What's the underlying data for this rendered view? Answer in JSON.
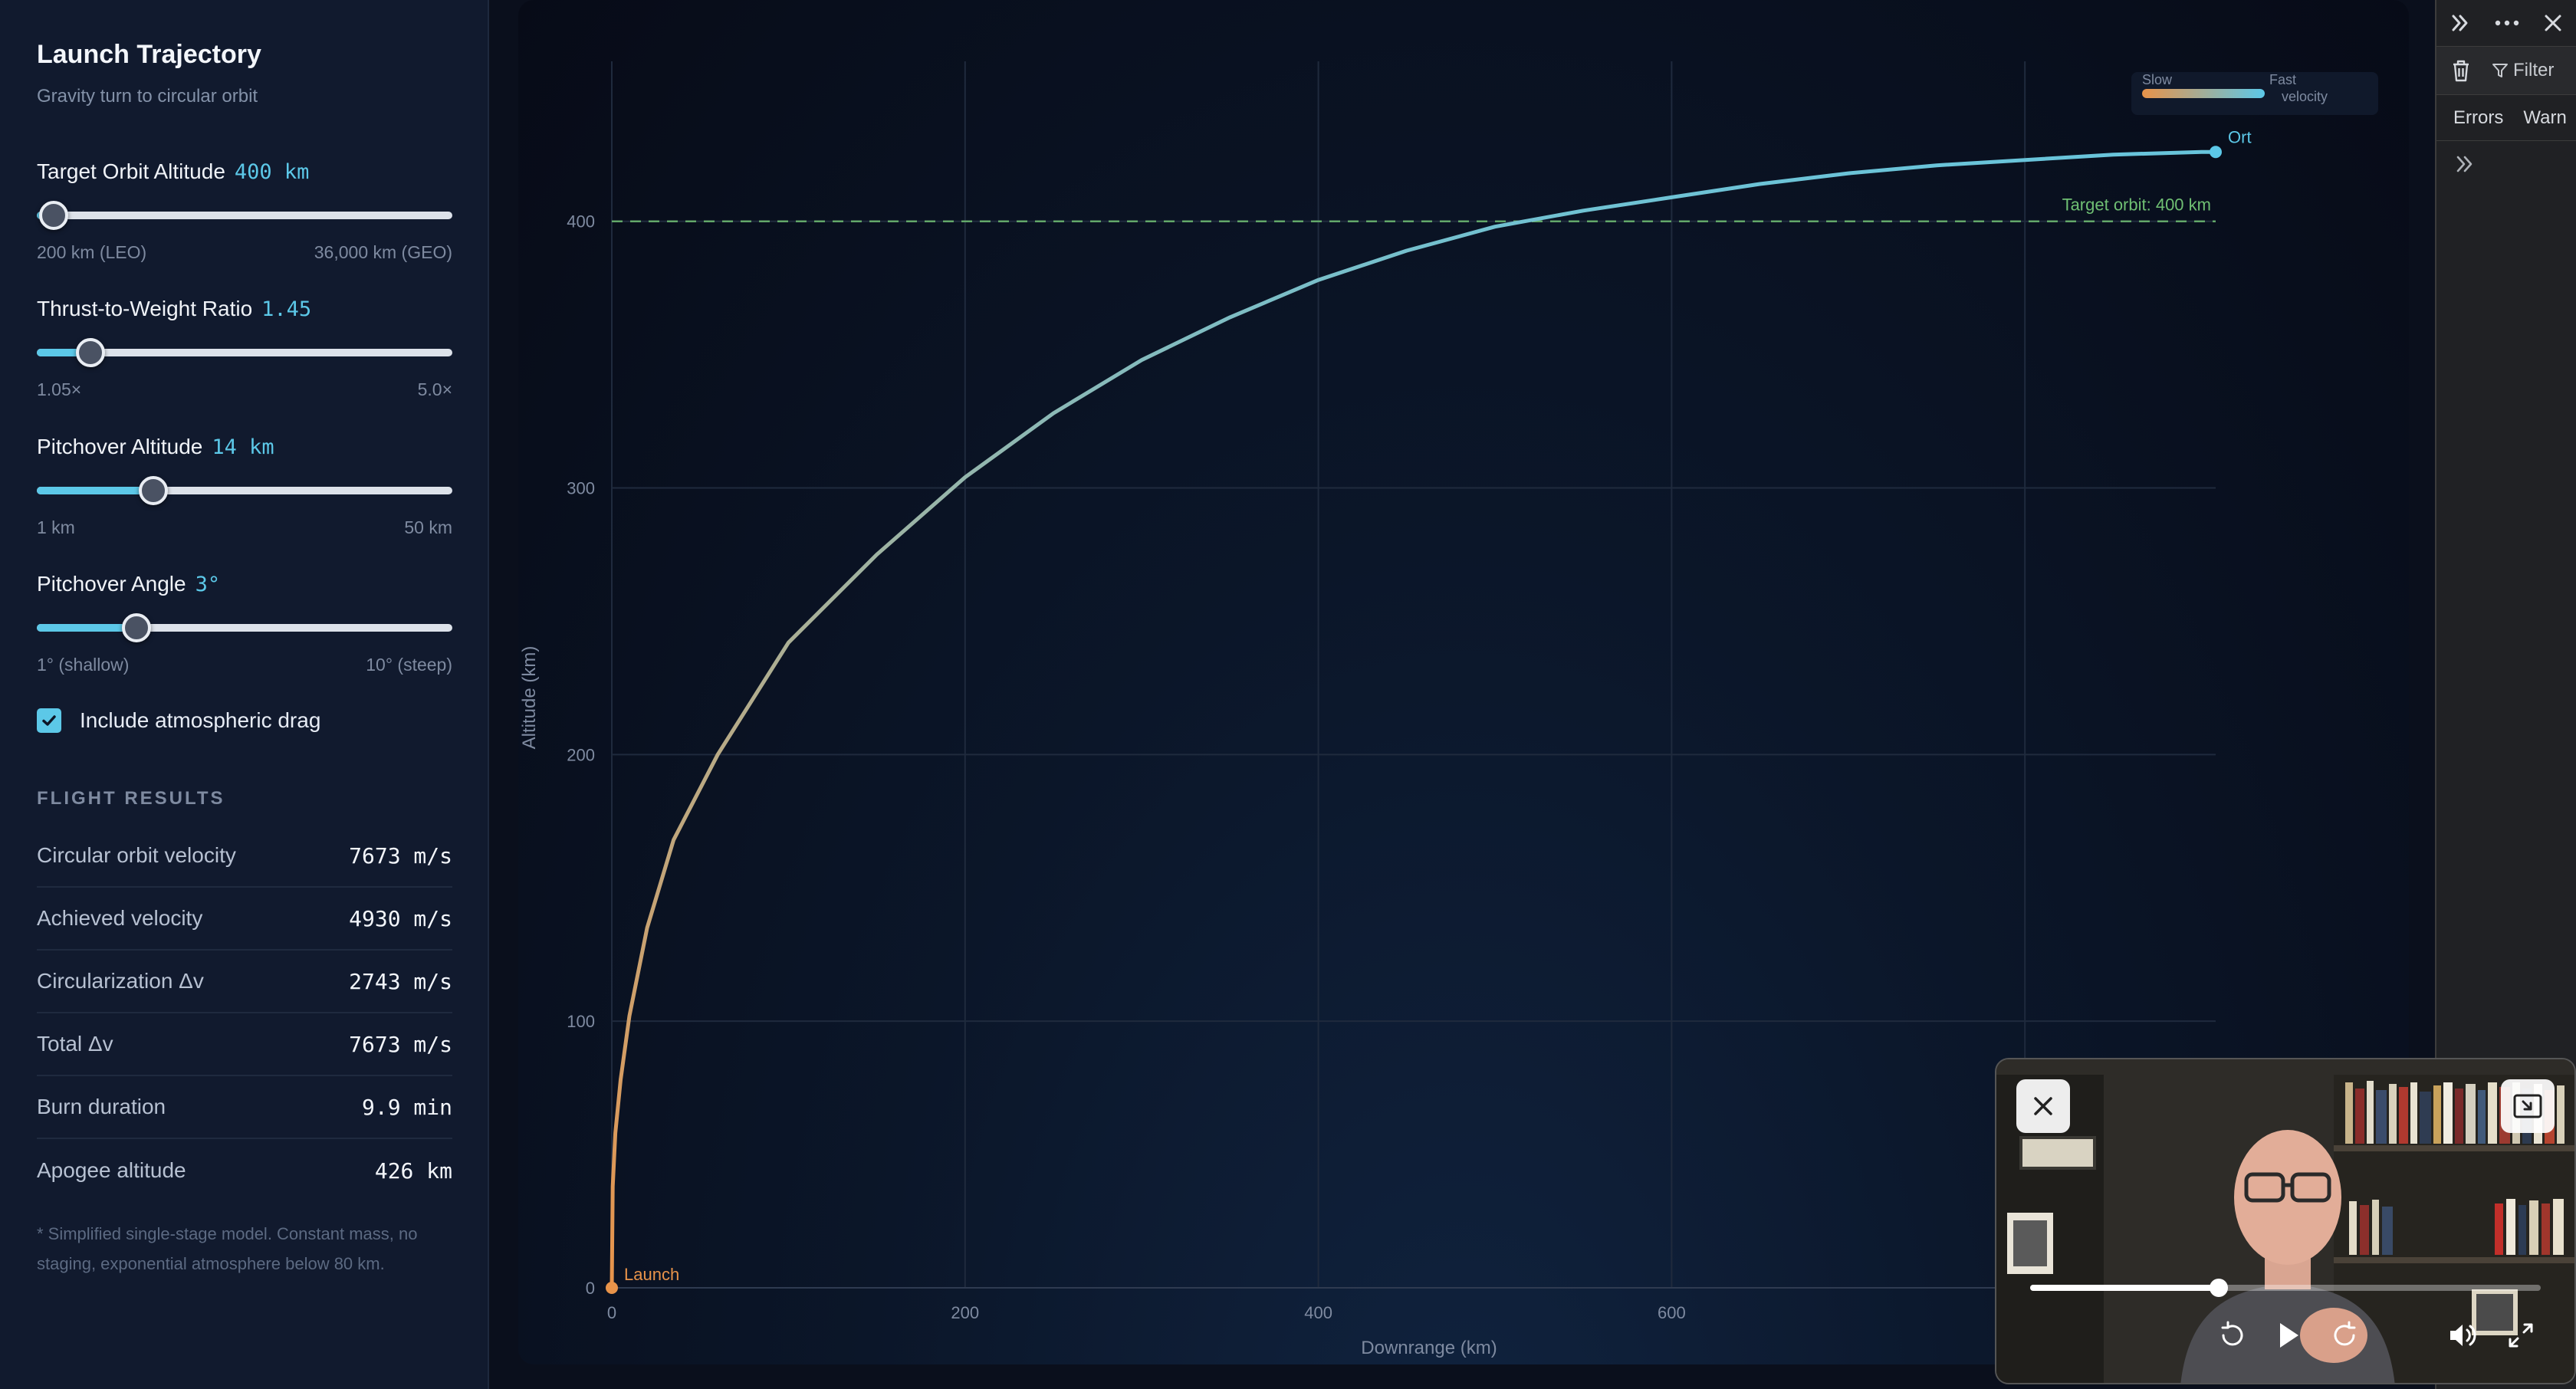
{
  "sidebar": {
    "title": "Launch Trajectory",
    "subtitle": "Gravity turn to circular orbit",
    "controls": [
      {
        "label": "Target Orbit Altitude",
        "value": "400 km",
        "min_label": "200 km (LEO)",
        "max_label": "36,000 km (GEO)",
        "position": 0.04
      },
      {
        "label": "Thrust-to-Weight Ratio",
        "value": "1.45",
        "min_label": "1.05×",
        "max_label": "5.0×",
        "position": 0.13
      },
      {
        "label": "Pitchover Altitude",
        "value": "14 km",
        "min_label": "1 km",
        "max_label": "50 km",
        "position": 0.28
      },
      {
        "label": "Pitchover Angle",
        "value": "3°",
        "min_label": "1° (shallow)",
        "max_label": "10° (steep)",
        "position": 0.24
      }
    ],
    "drag_checkbox": {
      "label": "Include atmospheric drag",
      "checked": true
    },
    "results_title": "FLIGHT RESULTS",
    "results": [
      {
        "label": "Circular orbit velocity",
        "value": "7673 m/s"
      },
      {
        "label": "Achieved velocity",
        "value": "4930 m/s"
      },
      {
        "label": "Circularization Δv",
        "value": "2743 m/s"
      },
      {
        "label": "Total Δv",
        "value": "7673 m/s"
      },
      {
        "label": "Burn duration",
        "value": "9.9 min"
      },
      {
        "label": "Apogee altitude",
        "value": "426 km"
      }
    ],
    "footnote": "* Simplified single-stage model. Constant mass, no staging, exponential atmosphere below 80 km."
  },
  "chart_data": {
    "type": "line",
    "xlabel": "Downrange (km)",
    "ylabel": "Altitude (km)",
    "xlim": [
      0,
      455
    ],
    "ylim": [
      0,
      460
    ],
    "x_ticks": [
      0,
      200,
      400,
      600
    ],
    "y_ticks": [
      0,
      100,
      200,
      300,
      400
    ],
    "grid": true,
    "series": [
      {
        "x": [
          0,
          0.5,
          2,
          5,
          10,
          20,
          35,
          60,
          100,
          150,
          200,
          250,
          300,
          350,
          400,
          450,
          500,
          550,
          600,
          650,
          700,
          750,
          800,
          850,
          900,
          908
        ],
        "y": [
          0,
          38,
          58,
          78,
          102,
          135,
          168,
          200,
          242,
          275,
          304,
          328,
          348,
          364,
          378,
          389,
          398,
          404,
          409,
          414,
          418,
          421,
          423,
          425,
          426,
          426
        ]
      }
    ],
    "target_line": {
      "y": 400,
      "label": "Target orbit: 400 km"
    },
    "start_marker_label": "Launch",
    "end_marker_label": "Ort",
    "colorbar": {
      "low_label": "Slow",
      "high_label": "Fast",
      "title": "velocity",
      "low_color": "#e8934a",
      "high_color": "#5cc8e8"
    },
    "colors": {
      "target_line": "#6fbf73",
      "grid": "#1f2a3d",
      "axis_text": "#7e8aa0"
    }
  },
  "devtools": {
    "filter_label": "Filter",
    "tabs": [
      "Errors",
      "Warn"
    ]
  },
  "video": {
    "progress": 0.37
  }
}
